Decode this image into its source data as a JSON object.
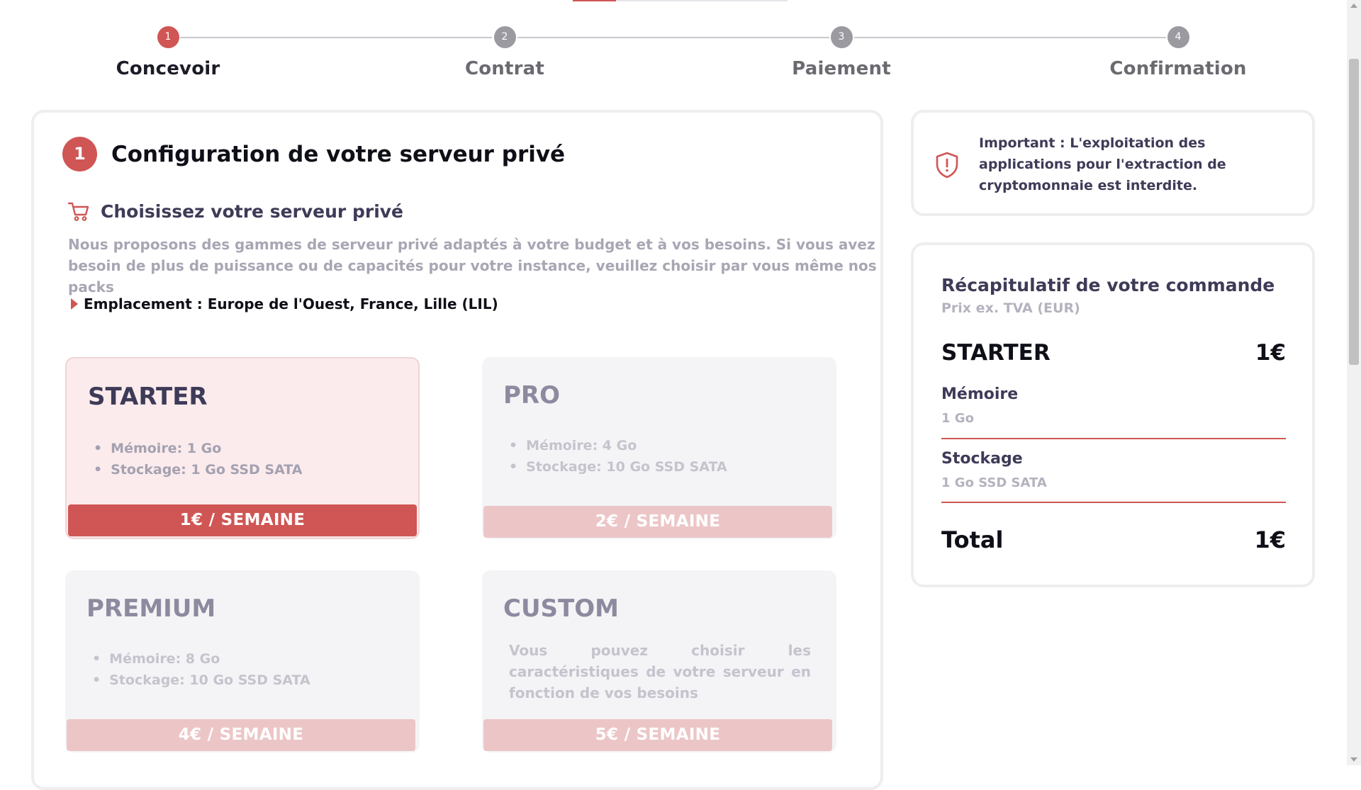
{
  "stepper": {
    "steps": [
      {
        "number": "1",
        "label": "Concevoir",
        "active": true
      },
      {
        "number": "2",
        "label": "Contrat",
        "active": false
      },
      {
        "number": "3",
        "label": "Paiement",
        "active": false
      },
      {
        "number": "4",
        "label": "Confirmation",
        "active": false
      }
    ]
  },
  "config": {
    "step_number": "1",
    "title": "Configuration de votre serveur privé",
    "choose_title": "Choisissez votre serveur privé",
    "description": "Nous proposons des gammes de serveur privé adaptés à votre budget et à vos besoins. Si vous avez besoin de plus de puissance ou de capacités pour votre instance, veuillez choisir par vous même nos packs",
    "location": "Emplacement : Europe de l'Ouest, France, Lille (LIL)"
  },
  "plans": [
    {
      "name": "STARTER",
      "memory": "Mémoire: 1 Go",
      "storage": "Stockage: 1 Go SSD SATA",
      "price": "1€ / SEMAINE",
      "selected": true
    },
    {
      "name": "PRO",
      "memory": "Mémoire: 4 Go",
      "storage": "Stockage: 10 Go SSD SATA",
      "price": "2€ / SEMAINE",
      "selected": false
    },
    {
      "name": "PREMIUM",
      "memory": "Mémoire: 8 Go",
      "storage": "Stockage: 10 Go SSD SATA",
      "price": "4€ / SEMAINE",
      "selected": false
    },
    {
      "name": "CUSTOM",
      "description": "Vous pouvez choisir les caractéristiques de votre serveur en fonction de vos besoins",
      "price": "5€ / SEMAINE",
      "selected": false
    }
  ],
  "warning": {
    "icon": "shield-alert-icon",
    "text": "Important : L'exploitation des applications pour l'extraction de cryptomonnaie est interdite."
  },
  "summary": {
    "title": "Récapitulatif de votre commande",
    "subtitle": "Prix ex. TVA (EUR)",
    "plan": "STARTER",
    "plan_price": "1€",
    "memory_label": "Mémoire",
    "memory_value": "1 Go",
    "storage_label": "Stockage",
    "storage_value": "1 Go SSD SATA",
    "total_label": "Total",
    "total_price": "1€"
  },
  "colors": {
    "accent": "#cf5654",
    "accent_light": "#ecc6c7",
    "selected_bg": "#fbebec",
    "heading": "#3e3b58",
    "muted": "#a9a6b4"
  }
}
